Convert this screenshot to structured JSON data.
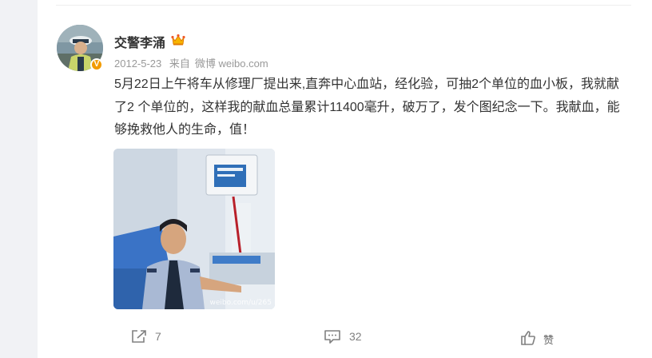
{
  "post": {
    "author": "交警李涌",
    "date": "2012-5-23",
    "source_prefix": "来自",
    "source": "微博 weibo.com",
    "text": "5月22日上午将车从修理厂提出来,直奔中心血站，经化验，可抽2个单位的血小板，我就献了2 个单位的，这样我的献血总量累计11400毫升，破万了，发个图纪念一下。我献血，能够挽救他人的生命，值！",
    "verified_mark": "V",
    "watermark": "weibo.com/u/265"
  },
  "actions": {
    "share_count": "7",
    "comment_count": "32",
    "like_label": "赞"
  },
  "colors": {
    "page_bg": "#f1f2f5",
    "text": "#333333",
    "meta": "#999999",
    "badge": "#f29b00"
  }
}
